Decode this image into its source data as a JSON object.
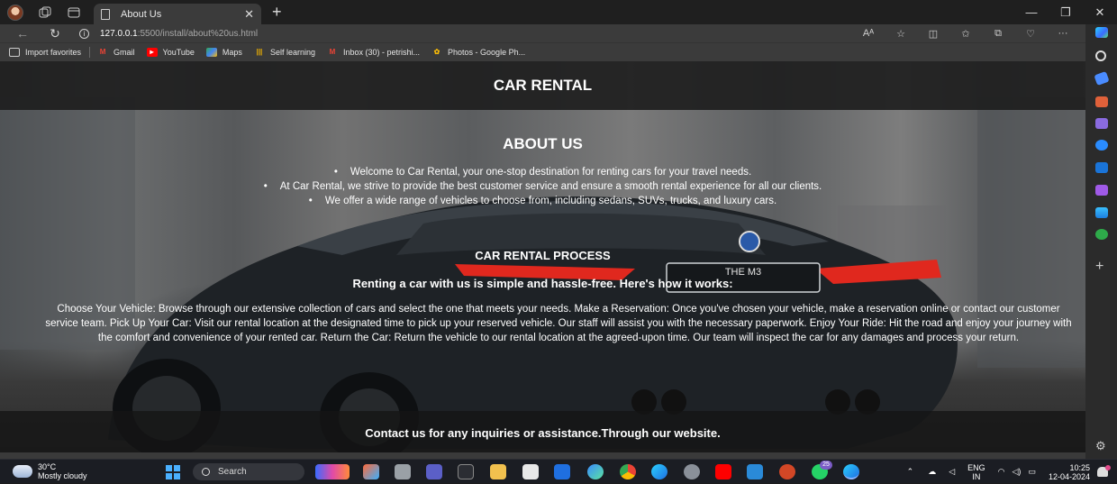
{
  "browser": {
    "tab_title": "About Us",
    "url_host": "127.0.0.1",
    "url_path": ":5500/install/about%20us.html",
    "bookmarks": [
      {
        "label": "Import favorites",
        "icon": "import-icon"
      },
      {
        "label": "Gmail",
        "icon": "gmail-icon"
      },
      {
        "label": "YouTube",
        "icon": "youtube-icon"
      },
      {
        "label": "Maps",
        "icon": "maps-icon"
      },
      {
        "label": "Self learning",
        "icon": "chart-bars-icon"
      },
      {
        "label": "Inbox (30) - petrishi...",
        "icon": "gmail-icon"
      },
      {
        "label": "Photos - Google Ph...",
        "icon": "google-photos-icon"
      }
    ]
  },
  "page": {
    "header_title": "CAR RENTAL",
    "about_title": "ABOUT US",
    "about_items": [
      "Welcome to Car Rental, your one-stop destination for renting cars for your travel needs.",
      "At Car Rental, we strive to provide the best customer service and ensure a smooth rental experience for all our clients.",
      "We offer a wide range of vehicles to choose from, including sedans, SUVs, trucks, and luxury cars."
    ],
    "process_title": "CAR RENTAL PROCESS",
    "process_subtitle": "Renting a car with us is simple and hassle-free. Here's how it works:",
    "process_body": "Choose Your Vehicle: Browse through our extensive collection of cars and select the one that meets your needs. Make a Reservation: Once you've chosen your vehicle, make a reservation online or contact our customer service team. Pick Up Your Car: Visit our rental location at the designated time to pick up your reserved vehicle. Our staff will assist you with the necessary paperwork. Enjoy Your Ride: Hit the road and enjoy your journey with the comfort and convenience of your rented car. Return the Car: Return the vehicle to our rental location at the agreed-upon time. Our team will inspect the car for any damages and process your return.",
    "contact_text": "Contact us for any inquiries or assistance.Through our website.",
    "plate_text": "THE M3"
  },
  "taskbar": {
    "temperature": "30°C",
    "weather": "Mostly cloudy",
    "search_label": "Search",
    "lang_top": "ENG",
    "lang_bottom": "IN",
    "time": "10:25",
    "date": "12-04-2024",
    "whatsapp_badge": "25"
  },
  "colors": {
    "header_bg": "#1e1e1e",
    "text": "#ffffff",
    "chrome_bg": "#3b3b3b",
    "taillight": "#e0281e"
  }
}
